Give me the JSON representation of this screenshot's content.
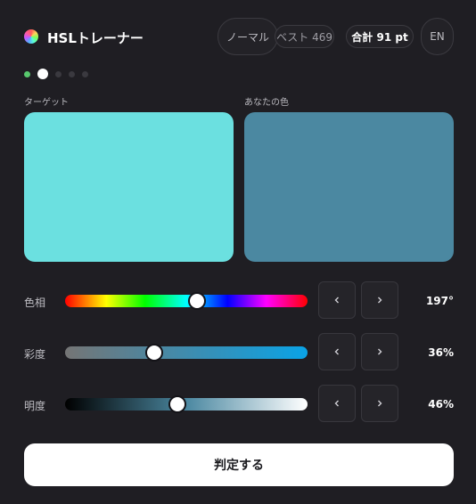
{
  "header": {
    "title": "HSLトレーナー",
    "mode_label": "ノーマル",
    "best_label": "ベスト 469",
    "total_label": "合計 91 pt",
    "lang_label": "EN"
  },
  "progress": {
    "total_rounds": 5,
    "completed": 1,
    "current_index": 1
  },
  "swatches": {
    "target_label": "ターゲット",
    "target_color": "#6be0e0",
    "yours_label": "あなたの色",
    "yours_color": "#4b88a1"
  },
  "sliders": [
    {
      "key": "hue",
      "label": "色相",
      "value": 197,
      "max": 360,
      "display": "197°"
    },
    {
      "key": "saturation",
      "label": "彩度",
      "value": 36,
      "max": 100,
      "display": "36%"
    },
    {
      "key": "lightness",
      "label": "明度",
      "value": 46,
      "max": 100,
      "display": "46%"
    }
  ],
  "icons": {
    "decrement": "chevron-left-icon",
    "increment": "chevron-right-icon",
    "logo": "color-wheel-icon"
  },
  "judge_label": "判定する"
}
